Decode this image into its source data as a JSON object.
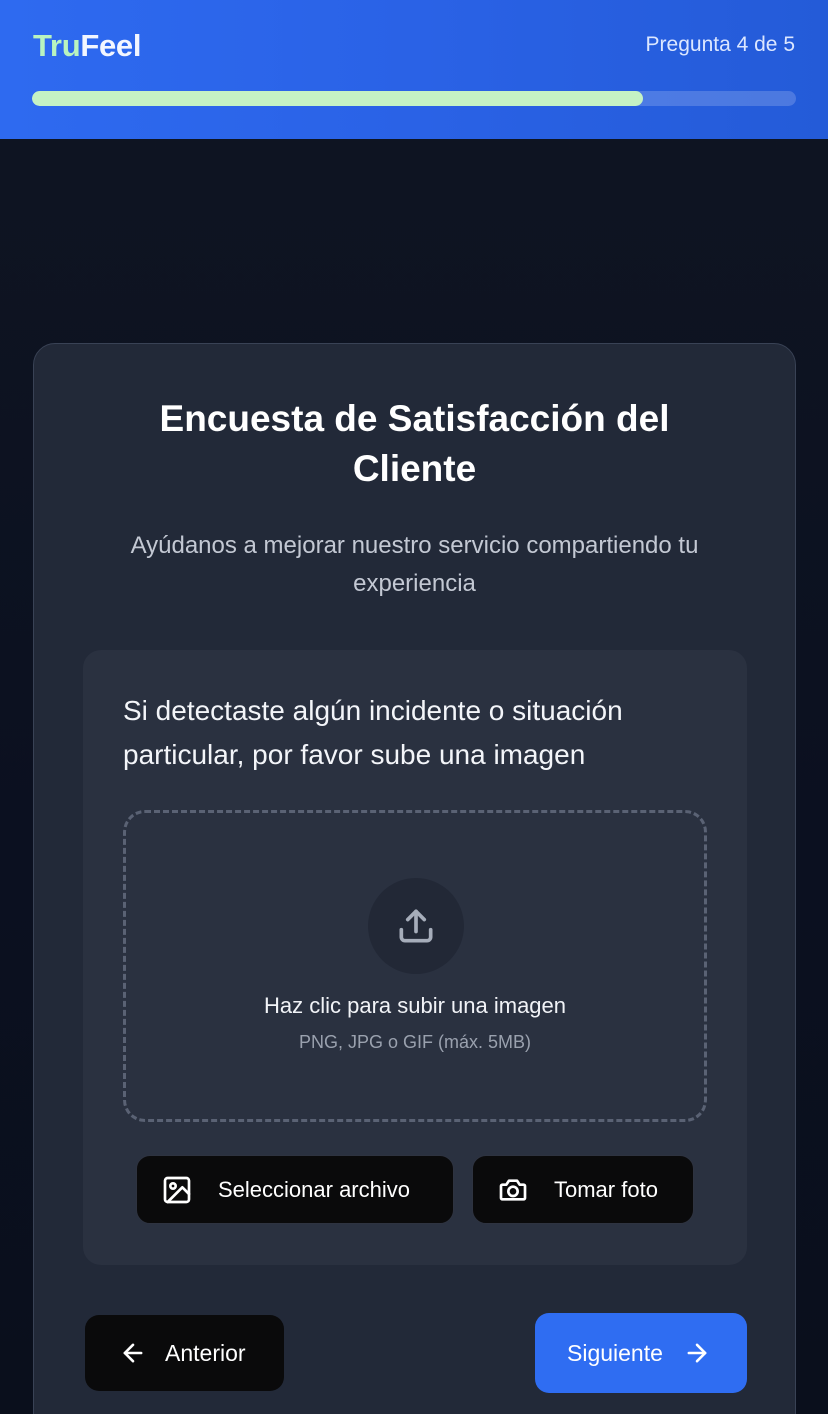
{
  "header": {
    "logo_part1": "Tru",
    "logo_part2": "Feel",
    "step_label": "Pregunta 4 de 5",
    "progress_percent": 80
  },
  "card": {
    "title": "Encuesta de Satisfacción del Cliente",
    "subtitle": "Ayúdanos a mejorar nuestro servicio compartiendo tu experiencia"
  },
  "question": {
    "text": "Si detectaste algún incidente o situación particular, por favor sube una imagen",
    "dropzone_title": "Haz clic para subir una imagen",
    "dropzone_hint": "PNG, JPG o GIF (máx. 5MB)",
    "select_file_label": "Seleccionar archivo",
    "take_photo_label": "Tomar foto"
  },
  "nav": {
    "prev_label": "Anterior",
    "next_label": "Siguiente"
  },
  "colors": {
    "header_blue": "#2e6af0",
    "progress_green": "#c5f2c4",
    "primary_button": "#2f6df2",
    "card_bg": "#222938"
  },
  "icons": {
    "upload": "upload-icon",
    "image": "image-icon",
    "camera": "camera-icon",
    "arrow_left": "arrow-left-icon",
    "arrow_right": "arrow-right-icon"
  }
}
